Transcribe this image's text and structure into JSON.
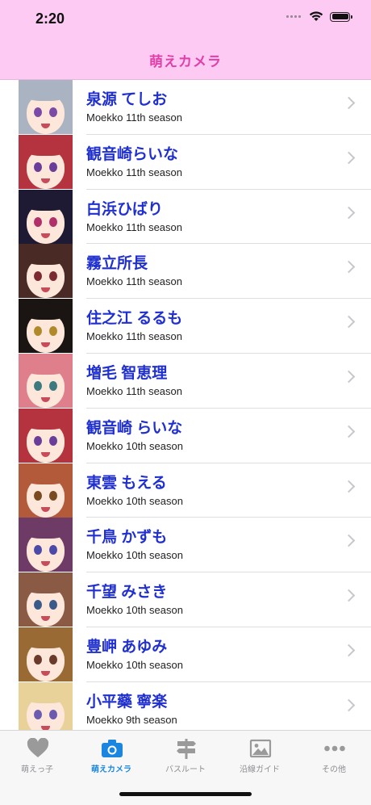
{
  "status": {
    "time": "2:20"
  },
  "nav": {
    "title": "萌えカメラ"
  },
  "list": [
    {
      "name": "泉源 てしお",
      "season": "Moekko 11th season",
      "hair": "#a9b3c2",
      "eye": "#7a4aa8"
    },
    {
      "name": "観音崎らいな",
      "season": "Moekko 11th season",
      "hair": "#b5333f",
      "eye": "#6a3d98"
    },
    {
      "name": "白浜ひばり",
      "season": "Moekko 11th season",
      "hair": "#1e1a33",
      "eye": "#b0306a"
    },
    {
      "name": "霧立所長",
      "season": "Moekko 11th season",
      "hair": "#4a2a24",
      "eye": "#7a2a30"
    },
    {
      "name": "住之江 るるも",
      "season": "Moekko 11th season",
      "hair": "#1a1512",
      "eye": "#b08a2a"
    },
    {
      "name": "増毛 智恵理",
      "season": "Moekko 11th season",
      "hair": "#e07f8c",
      "eye": "#3c7a80"
    },
    {
      "name": "観音崎 らいな",
      "season": "Moekko 10th season",
      "hair": "#b5333f",
      "eye": "#6a3d98"
    },
    {
      "name": "東雲 もえる",
      "season": "Moekko 10th season",
      "hair": "#b35a3a",
      "eye": "#7a4a20"
    },
    {
      "name": "千鳥 かずも",
      "season": "Moekko 10th season",
      "hair": "#6e3a66",
      "eye": "#4b4aa8"
    },
    {
      "name": "千望 みさき",
      "season": "Moekko 10th season",
      "hair": "#8a5a44",
      "eye": "#3a5a8a"
    },
    {
      "name": "豊岬 あゆみ",
      "season": "Moekko 10th season",
      "hair": "#9a6a34",
      "eye": "#6a3a2a"
    },
    {
      "name": "小平藥 寧楽",
      "season": "Moekko 9th season",
      "hair": "#e8d29a",
      "eye": "#6a5ab0"
    }
  ],
  "tabs": [
    {
      "label": "萌えっ子",
      "icon": "heart-icon",
      "active": false
    },
    {
      "label": "萌えカメラ",
      "icon": "camera-icon",
      "active": true
    },
    {
      "label": "バスルート",
      "icon": "signpost-icon",
      "active": false
    },
    {
      "label": "沿線ガイド",
      "icon": "photo-icon",
      "active": false
    },
    {
      "label": "その他",
      "icon": "more-icon",
      "active": false
    }
  ],
  "colors": {
    "accent": "#1a86e0",
    "inactive": "#9a9a9a",
    "nav_bg": "#fccaf2",
    "title": "#e040a8",
    "name": "#1f2fd0"
  }
}
